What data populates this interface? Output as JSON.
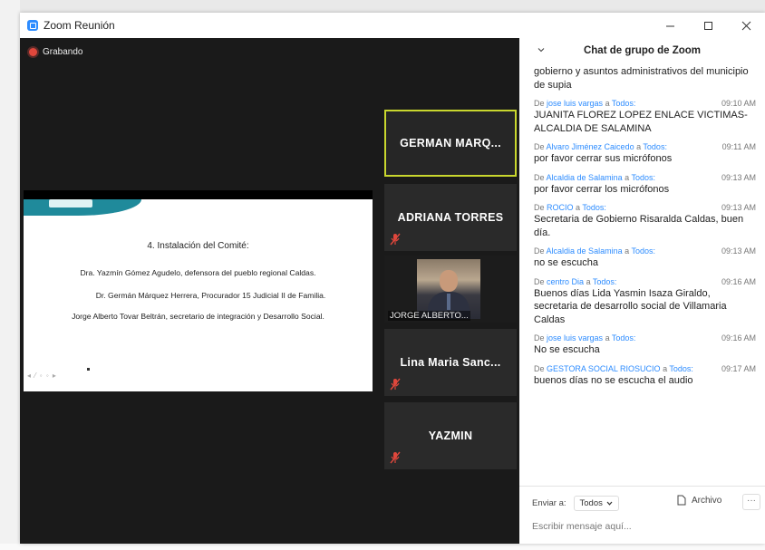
{
  "window": {
    "title": "Zoom Reunión",
    "controls": {
      "minimize": "–",
      "maximize": "□",
      "close": "×"
    }
  },
  "meeting": {
    "recording_label": "Grabando",
    "slide": {
      "title": "4. Instalación del Comité:",
      "lines": [
        "Dra. Yazmín  Gómez Agudelo, defensora del pueblo regional Caldas.",
        "Dr. Germán Márquez Herrera, Procurador 15 Judicial II de Familia.",
        "Jorge Alberto Tovar Beltrán, secretario de integración y Desarrollo Social."
      ],
      "controls": "◂ ⁄ ◦ ◦ ▸"
    },
    "participants": [
      {
        "name": "GERMAN  MARQ...",
        "active": true,
        "muted": false,
        "video": false
      },
      {
        "name": "ADRIANA TORRES",
        "active": false,
        "muted": true,
        "video": false
      },
      {
        "name": "JORGE ALBERTO...",
        "active": false,
        "muted": true,
        "video": true
      },
      {
        "name": "Lina Maria Sanc...",
        "active": false,
        "muted": true,
        "video": false
      },
      {
        "name": "YAZMIN",
        "active": false,
        "muted": true,
        "video": false
      }
    ]
  },
  "chat": {
    "title": "Chat de grupo de Zoom",
    "messages": [
      {
        "prefix": "",
        "sender": "",
        "to": "",
        "time": "",
        "text": "gobierno y asuntos administrativos del municipio de supia"
      },
      {
        "prefix": "De",
        "sender": "jose luis vargas",
        "to": "Todos:",
        "time": "09:10 AM",
        "text": "JUANITA FLOREZ LOPEZ ENLACE VICTIMAS-ALCALDIA DE SALAMINA"
      },
      {
        "prefix": "De",
        "sender": "Alvaro Jiménez Caicedo",
        "to": "Todos:",
        "time": "09:11 AM",
        "text": "por favor cerrar sus micrófonos"
      },
      {
        "prefix": "De",
        "sender": "Alcaldia de Salamina",
        "to": "Todos:",
        "time": "09:13 AM",
        "text": "por favor cerrar los micrófonos"
      },
      {
        "prefix": "De",
        "sender": "ROCIO",
        "to": "Todos:",
        "time": "09:13 AM",
        "text": "Secretaria de Gobierno Risaralda Caldas, buen día."
      },
      {
        "prefix": "De",
        "sender": "Alcaldia de Salamina",
        "to": "Todos:",
        "time": "09:13 AM",
        "text": "no se escucha"
      },
      {
        "prefix": "De",
        "sender": "centro Dia",
        "to": "Todos:",
        "time": "09:16 AM",
        "text": "Buenos días Lida Yasmin Isaza Giraldo, secretaria de desarrollo social de Villamaria Caldas"
      },
      {
        "prefix": "De",
        "sender": "jose luis vargas",
        "to": "Todos:",
        "time": "09:16 AM",
        "text": "No se escucha"
      },
      {
        "prefix": "De",
        "sender": "GESTORA SOCIAL RIOSUCIO",
        "to": "Todos:",
        "time": "09:17 AM",
        "text": "buenos días no se escucha el audio"
      }
    ],
    "send_to_label": "Enviar a:",
    "send_to_value": "Todos",
    "file_label": "Archivo",
    "more_label": "···",
    "input_placeholder": "Escribir mensaje aquí..."
  },
  "colors": {
    "accent": "#2d8cff",
    "active_speaker_border": "#c9d72e",
    "recording": "#e0473c",
    "muted_mic": "#e0473c"
  }
}
